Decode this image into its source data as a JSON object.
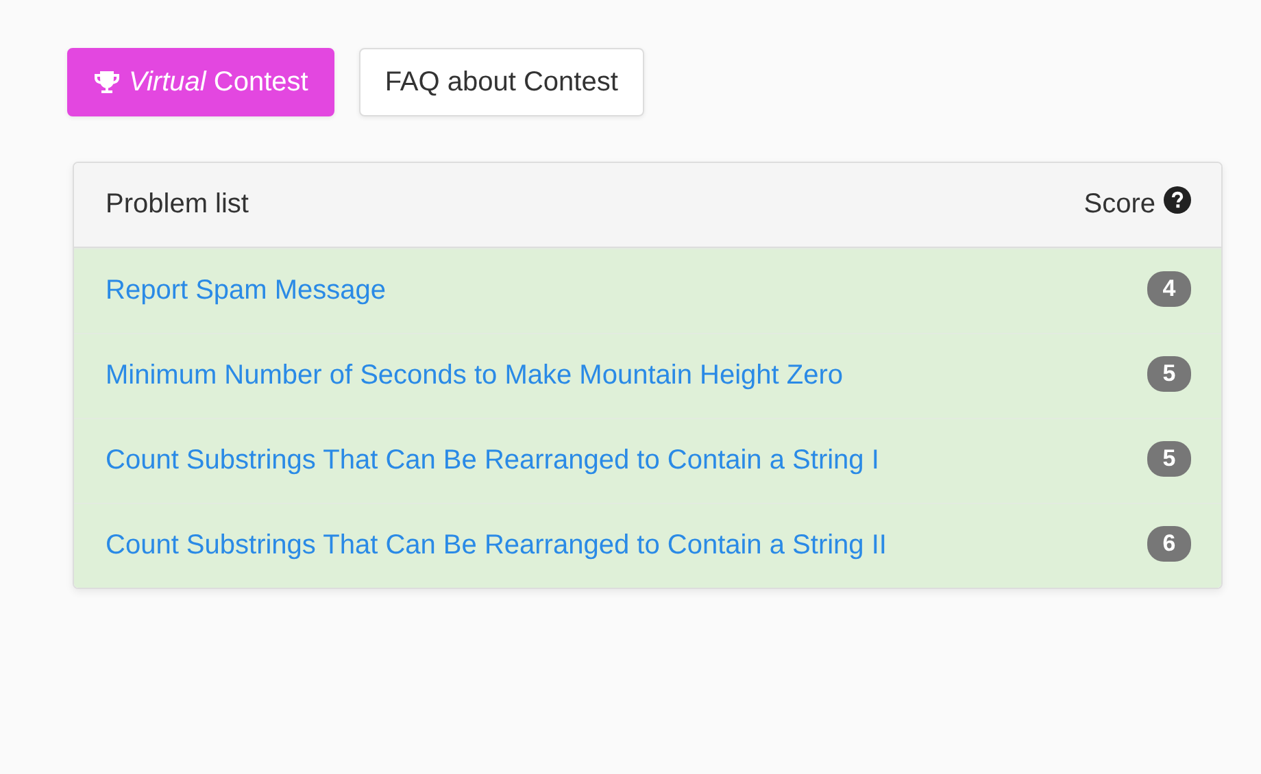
{
  "buttons": [
    {
      "kind": "primary",
      "label": "*Virtual* Contest"
    },
    {
      "kind": "default",
      "label": "FAQ about Contest"
    }
  ],
  "problem_list": {
    "title": "Problem list",
    "score_header": "Score",
    "rows": [
      {
        "title": "Report Spam Message",
        "score": "4",
        "solved": true
      },
      {
        "title": "Minimum Number of Seconds to Make Mountain Height Zero",
        "score": "5",
        "solved": true
      },
      {
        "title": "Count Substrings That Can Be Rearranged to Contain a String I",
        "score": "5",
        "solved": true
      },
      {
        "title": "Count Substrings That Can Be Rearranged to Contain a String II",
        "score": "6",
        "solved": true
      }
    ]
  }
}
